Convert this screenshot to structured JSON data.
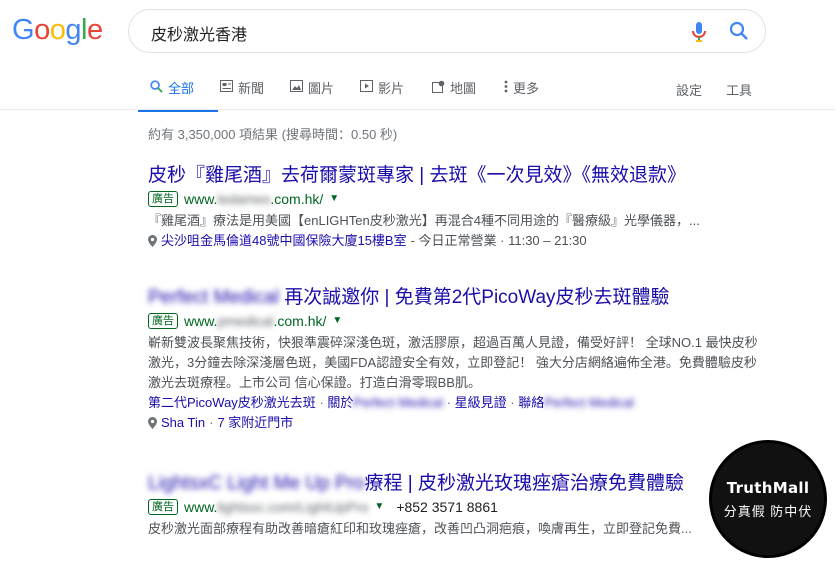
{
  "logo": {
    "letters": [
      "G",
      "o",
      "o",
      "g",
      "l",
      "e"
    ]
  },
  "search": {
    "query": "皮秒激光香港"
  },
  "tabs": [
    {
      "label": "全部",
      "icon": "search-icon"
    },
    {
      "label": "新聞",
      "icon": "news-icon"
    },
    {
      "label": "圖片",
      "icon": "image-icon"
    },
    {
      "label": "影片",
      "icon": "video-icon"
    },
    {
      "label": "地圖",
      "icon": "map-icon"
    },
    {
      "label": "更多",
      "icon": "more-vert-icon"
    }
  ],
  "tools": {
    "settings": "設定",
    "tools": "工具"
  },
  "stats": "約有 3,350,000 項結果 (搜尋時間：0.50 秒)",
  "results": [
    {
      "title": "皮秒『雞尾酒』去荷爾蒙斑專家 | 去斑《一次見效》《無效退款》",
      "ad": "廣告",
      "url_prefix": "www.",
      "url_blur": "ledames",
      "url_suffix": ".com.hk/",
      "snippet": "『雞尾酒』療法是用美國【enLIGHTen皮秒激光】再混合4種不同用途的『醫療級』光學儀器，...",
      "location": "尖沙咀金馬倫道48號中國保險大廈15樓B室",
      "hours": " - 今日正常營業 · 11:30 – 21:30"
    },
    {
      "title_blur": "Perfect Medical",
      "title": " 再次誠邀你 | 免費第2代PicoWay皮秒去斑體驗",
      "ad": "廣告",
      "url_prefix": "www.",
      "url_blur": "pmedical",
      "url_suffix": ".com.hk/",
      "snippet": "嶄新雙波長聚焦技術，快狠準震碎深淺色斑，激活膠原，超過百萬人見證，備受好評！ 全球NO.1 最快皮秒激光，3分鐘去除深淺層色斑，美國FDA認證安全有效，立即登記！ 強大分店網絡遍佈全港。免費體驗皮秒激光去斑療程。上市公司 信心保證。打造白滑零瑕BB肌。",
      "sitelink1": "第二代PicoWay皮秒激光去斑",
      "sitelink2_prefix": "關於",
      "sitelink2_blur": "Perfect Medical",
      "sitelink3": "星級見證",
      "sitelink4_prefix": "聯絡",
      "sitelink4_blur": "Perfect Medical",
      "location": "Sha Tin",
      "branches": "7 家附近門市"
    },
    {
      "title_blur": "LightsxC Light Me Up Pro",
      "title": "療程 | 皮秒激光玫瑰痤瘡治療免費體驗",
      "ad": "廣告",
      "url_prefix": "www.",
      "url_blur": "lightsxc.com/LightUpPro",
      "phone": "+852 3571 8861",
      "snippet": "皮秒激光面部療程有助改善暗瘡紅印和玫瑰痤瘡，改善凹凸洞疤痕，喚膚再生，立即登記免費..."
    }
  ],
  "watermark": {
    "brand": "TruthMall",
    "slogan": "分真假 防中伏"
  },
  "colors": {
    "link": "#1a0dab",
    "url": "#006621",
    "accent": "#1a73e8"
  }
}
